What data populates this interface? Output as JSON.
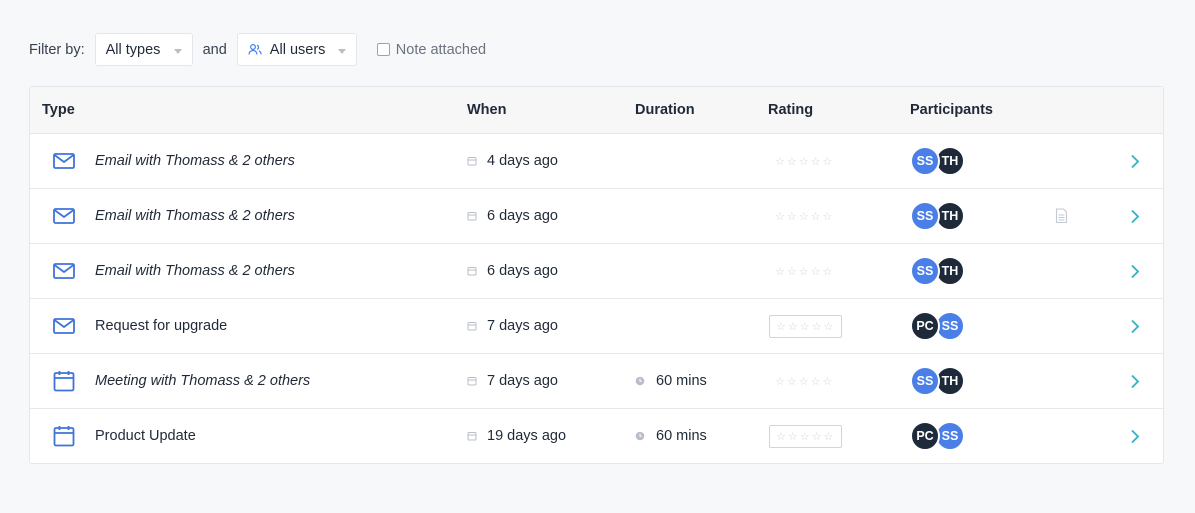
{
  "filters": {
    "label": "Filter by:",
    "type_select": {
      "value": "All types"
    },
    "conjunction": "and",
    "user_select": {
      "value": "All users",
      "icon": "users-icon"
    },
    "note_checkbox": {
      "label": "Note attached",
      "checked": false
    }
  },
  "table": {
    "columns": [
      "Type",
      "When",
      "Duration",
      "Rating",
      "Participants"
    ],
    "rows": [
      {
        "type": "email",
        "subject": "Email with Thomass & 2 others",
        "italic": true,
        "when": "4 days ago",
        "duration": "",
        "rating": 0,
        "rating_boxed": false,
        "participants": [
          {
            "initials": "SS",
            "color": "#4a7fe8"
          },
          {
            "initials": "TH",
            "color": "#1e2a3a"
          }
        ],
        "note": false
      },
      {
        "type": "email",
        "subject": "Email with Thomass & 2 others",
        "italic": true,
        "when": "6 days ago",
        "duration": "",
        "rating": 0,
        "rating_boxed": false,
        "participants": [
          {
            "initials": "SS",
            "color": "#4a7fe8"
          },
          {
            "initials": "TH",
            "color": "#1e2a3a"
          }
        ],
        "note": true
      },
      {
        "type": "email",
        "subject": "Email with Thomass & 2 others",
        "italic": true,
        "when": "6 days ago",
        "duration": "",
        "rating": 0,
        "rating_boxed": false,
        "participants": [
          {
            "initials": "SS",
            "color": "#4a7fe8"
          },
          {
            "initials": "TH",
            "color": "#1e2a3a"
          }
        ],
        "note": false
      },
      {
        "type": "email",
        "subject": "Request for upgrade",
        "italic": false,
        "when": "7 days ago",
        "duration": "",
        "rating": 0,
        "rating_boxed": true,
        "participants": [
          {
            "initials": "PC",
            "color": "#1e2a3a"
          },
          {
            "initials": "SS",
            "color": "#4a7fe8"
          }
        ],
        "note": false
      },
      {
        "type": "meeting",
        "subject": "Meeting with Thomass & 2 others",
        "italic": true,
        "when": "7 days ago",
        "duration": "60 mins",
        "rating": 0,
        "rating_boxed": false,
        "participants": [
          {
            "initials": "SS",
            "color": "#4a7fe8"
          },
          {
            "initials": "TH",
            "color": "#1e2a3a"
          }
        ],
        "note": false
      },
      {
        "type": "meeting",
        "subject": "Product Update",
        "italic": false,
        "when": "19 days ago",
        "duration": "60 mins",
        "rating": 0,
        "rating_boxed": true,
        "participants": [
          {
            "initials": "PC",
            "color": "#1e2a3a"
          },
          {
            "initials": "SS",
            "color": "#4a7fe8"
          }
        ],
        "note": false
      }
    ]
  },
  "colors": {
    "accent": "#4a7fe8",
    "dark_avatar": "#1e2a3a",
    "chevron": "#38b2c8",
    "icon_blue": "#3f74d9"
  }
}
